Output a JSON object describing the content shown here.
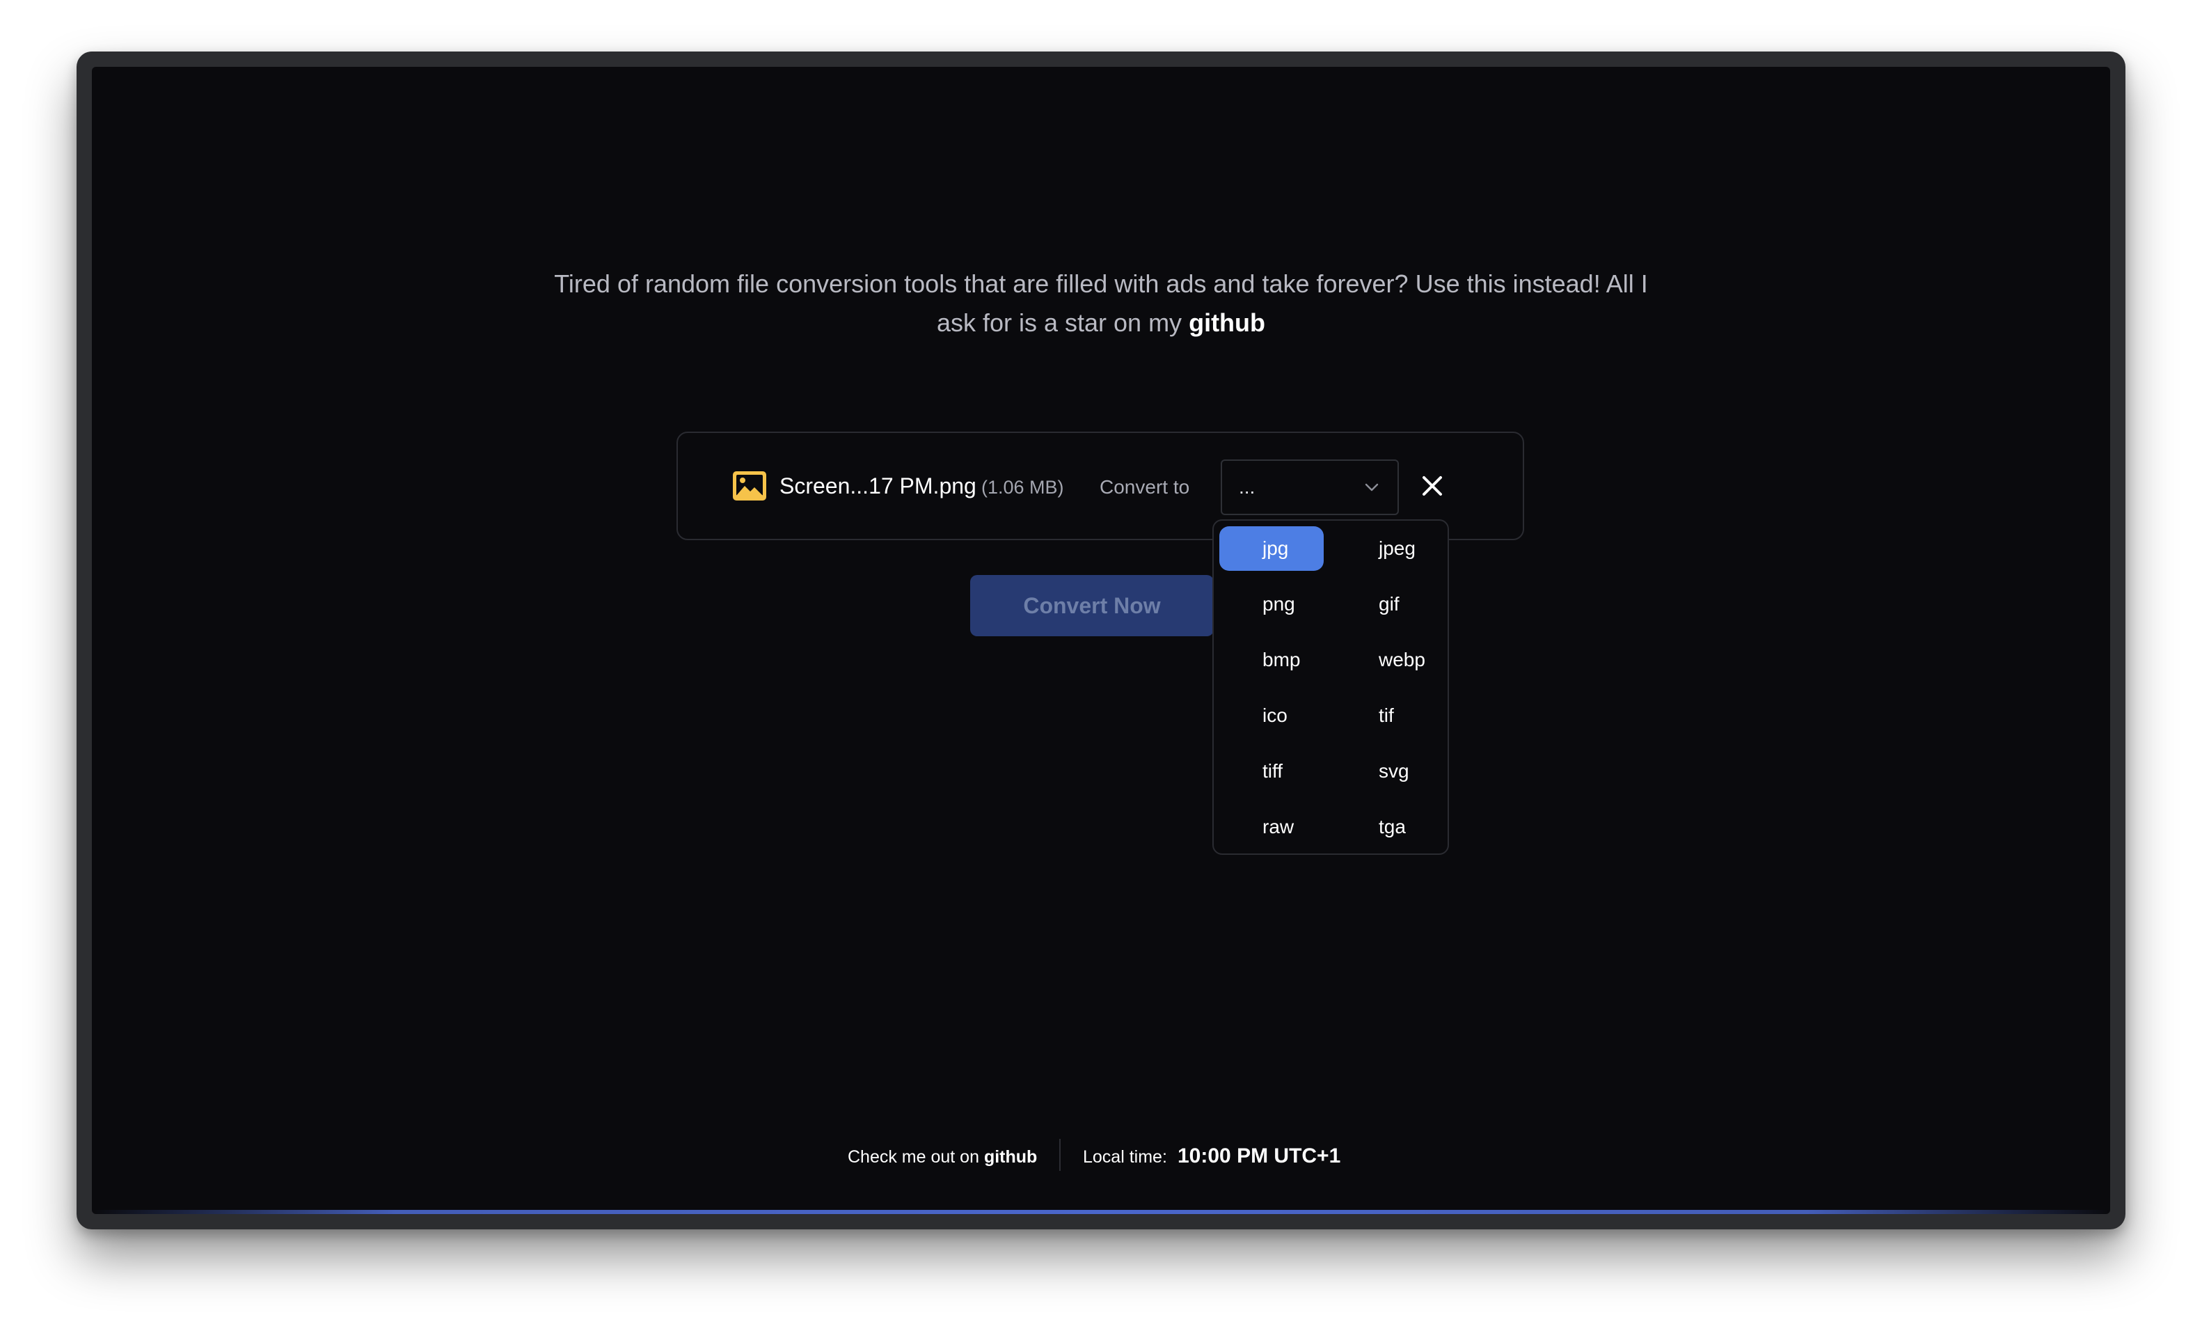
{
  "tagline": {
    "text_before": "Tired of random file conversion tools that are filled with ads and take forever? Use this instead! All I ask for is a star on my",
    "link": "github"
  },
  "file": {
    "icon": "image-file-icon",
    "name": "Screen...17 PM.png",
    "size": "(1.06 MB)"
  },
  "convert": {
    "label": "Convert to",
    "select_value": "...",
    "button_label": "Convert Now"
  },
  "dropdown": {
    "selected": "jpg",
    "options": [
      "jpg",
      "jpeg",
      "png",
      "gif",
      "bmp",
      "webp",
      "ico",
      "tif",
      "tiff",
      "svg",
      "raw",
      "tga"
    ]
  },
  "footer": {
    "prefix": "Check me out on",
    "link": "github",
    "time_label": "Local time:",
    "time_value": "10:00 PM UTC+1"
  },
  "colors": {
    "background": "#0a0a0d",
    "accent": "#4d7ee4",
    "button": "#273a72",
    "icon": "#f6c34a"
  }
}
